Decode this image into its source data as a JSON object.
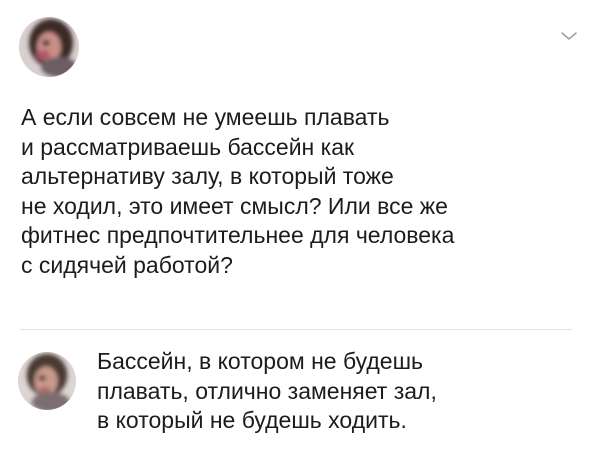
{
  "post": {
    "author": {
      "avatar_icon": "user-avatar",
      "name": "",
      "handle": ""
    },
    "menu_icon": "chevron-down-icon",
    "text": "А если совсем не умеешь плавать\nи рассматриваешь бассейн как\nальтернативу залу, в который тоже\nне ходил, это имеет смысл? Или все же\nфитнес предпочтительнее для человека\nс сидячей работой?"
  },
  "reply": {
    "author": {
      "avatar_icon": "user-avatar"
    },
    "text": "Бассейн, в котором не будешь\nплавать, отлично заменяет зал,\nв который не будешь ходить."
  },
  "colors": {
    "text": "#1c1c1c",
    "divider": "#e2e2e2",
    "background": "#ffffff",
    "chevron": "#9aa0a6"
  }
}
